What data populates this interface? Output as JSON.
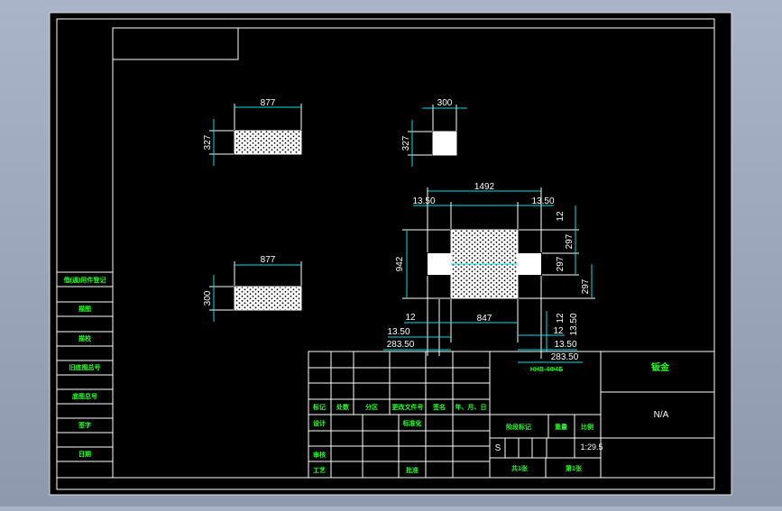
{
  "drawing": {
    "part1": {
      "width": "877",
      "height": "327"
    },
    "part2": {
      "width": "300",
      "height": "327"
    },
    "part3": {
      "width": "877",
      "height": "300"
    },
    "assembly": {
      "overall_width": "1492",
      "left_offset": "13.50",
      "right_offset": "13.50",
      "height": "942",
      "inner_width": "847",
      "right_dims": [
        "12",
        "297",
        "297",
        "297"
      ],
      "lower_right_dims": [
        "12",
        "13.50"
      ],
      "lower_left_dims": [
        "12",
        "13.50",
        "283.50"
      ],
      "bottom_right_dims": [
        "12",
        "13.50",
        "283.50"
      ],
      "part_label": "ННВ-4Ф4Б"
    }
  },
  "title_block": {
    "company": "钣金",
    "material": "N/A",
    "scale_left": "S",
    "weight": "1:29.5",
    "cols_left": [
      "标记",
      "处数",
      "分区",
      "更改文件号",
      "签名",
      "年、月、日"
    ],
    "rows_left": [
      "设计",
      "审核",
      "工艺"
    ],
    "standardize": "标准化",
    "approve": "批准",
    "stage_mark": "阶段标记",
    "weight_label": "重量",
    "scale_label": "比例",
    "sheet_total": "共1张",
    "sheet_no": "第1张"
  },
  "side_panel": [
    "借(通)用件登记",
    "描图",
    "描校",
    "旧底图总号",
    "底图总号",
    "签字",
    "日期"
  ]
}
